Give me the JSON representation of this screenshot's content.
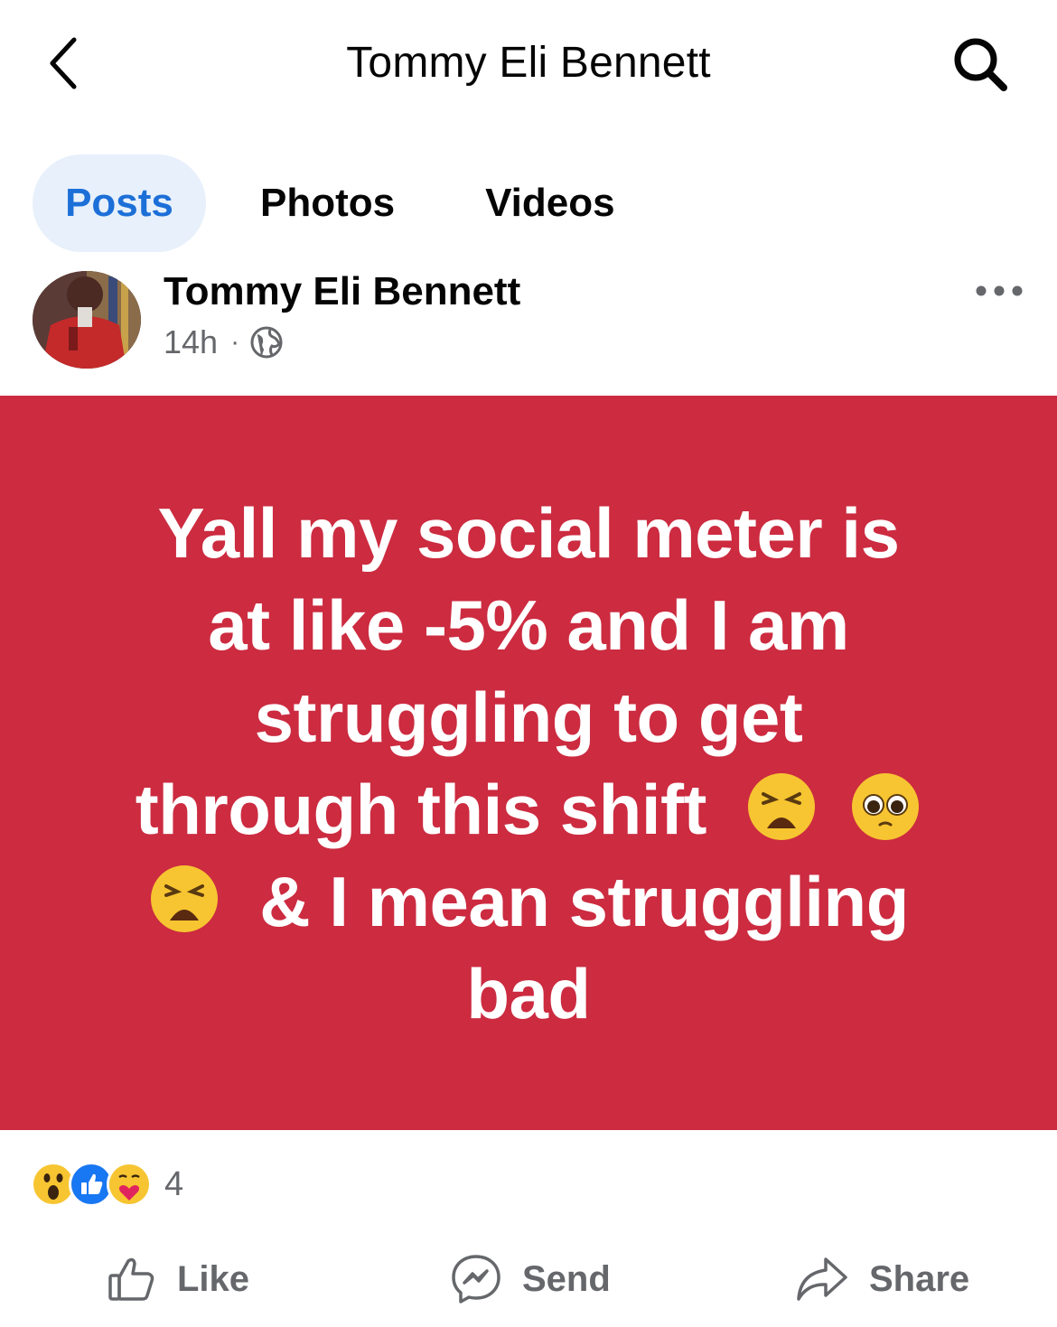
{
  "header": {
    "title": "Tommy Eli Bennett"
  },
  "tabs": [
    {
      "label": "Posts",
      "active": true
    },
    {
      "label": "Photos",
      "active": false
    },
    {
      "label": "Videos",
      "active": false
    }
  ],
  "post": {
    "author": "Tommy Eli Bennett",
    "time": "14h",
    "separator": "·",
    "privacy_icon": "globe-icon",
    "background_color": "#cc2b40",
    "text_lines": {
      "l1": "Yall my social meter is",
      "l2": "at like -5% and I am",
      "l3": "struggling to get",
      "l4": "through this shift",
      "l5": "& I mean struggling",
      "l6": "bad"
    },
    "reactions": {
      "icons": [
        "wow-reaction-icon",
        "like-reaction-icon",
        "care-reaction-icon"
      ],
      "count": "4"
    },
    "actions": {
      "like": "Like",
      "send": "Send",
      "share": "Share"
    }
  },
  "colors": {
    "accent": "#1d6fd8",
    "tab_active_bg": "#e7f0fb",
    "secondary_text": "#65676b"
  }
}
